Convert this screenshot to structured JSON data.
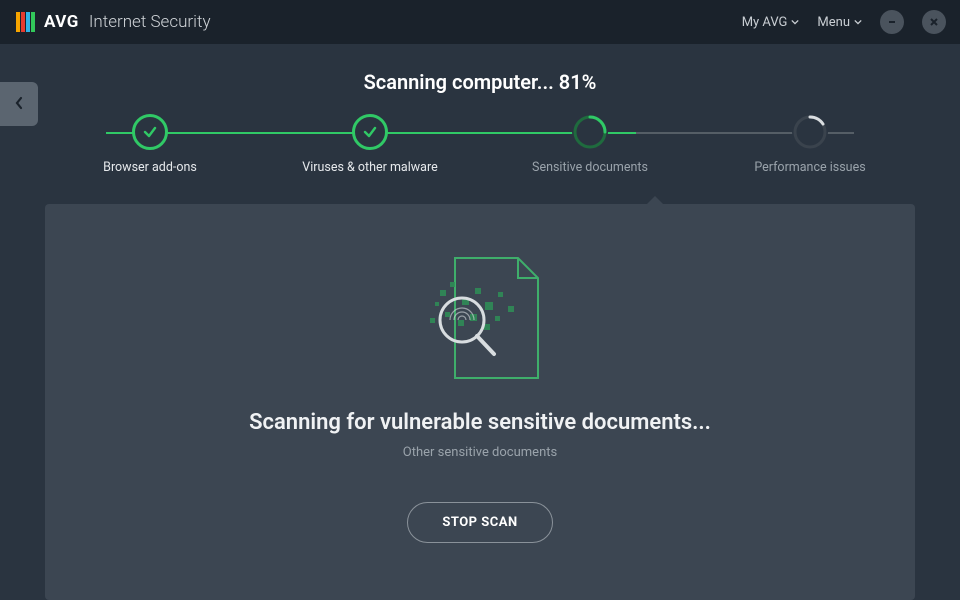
{
  "header": {
    "brand_strong": "AVG",
    "brand_light": "Internet Security",
    "my_avg": "My AVG",
    "menu": "Menu"
  },
  "scan": {
    "title_prefix": "Scanning computer... ",
    "percent": "81%",
    "heading": "Scanning for vulnerable sensitive documents...",
    "subtext": "Other sensitive documents",
    "stop_label": "STOP SCAN"
  },
  "steps": [
    {
      "label": "Browser add-ons",
      "state": "done"
    },
    {
      "label": "Viruses & other malware",
      "state": "done"
    },
    {
      "label": "Sensitive documents",
      "state": "active"
    },
    {
      "label": "Performance issues",
      "state": "pending"
    }
  ],
  "colors": {
    "accent_green": "#30c966",
    "bg_dark": "#1a222b",
    "bg_body": "#2a3440",
    "panel": "#3c4652"
  }
}
